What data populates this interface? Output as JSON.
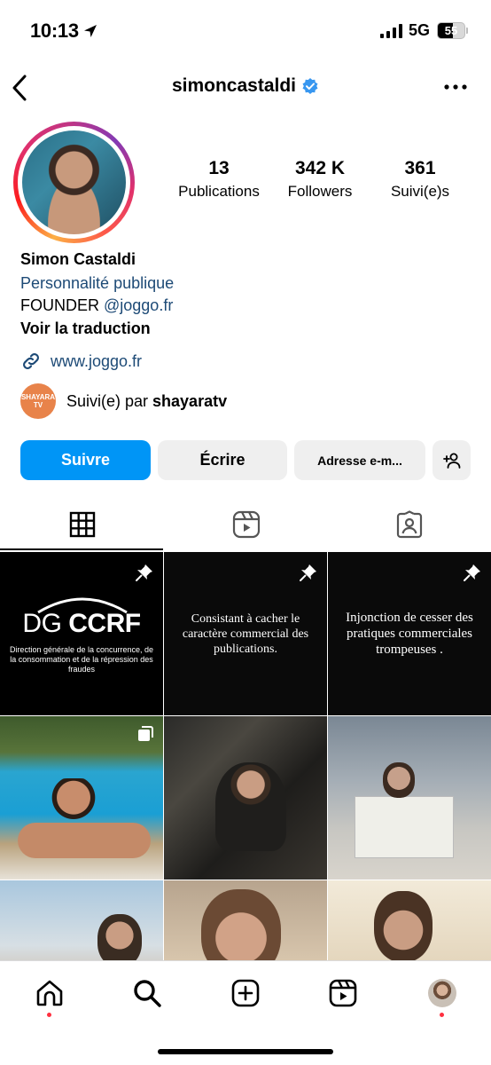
{
  "status_bar": {
    "time": "10:13",
    "network": "5G",
    "battery": "55",
    "battery_level": 0.55
  },
  "header": {
    "username": "simoncastaldi",
    "verified": true
  },
  "stats": [
    {
      "value": "13",
      "label": "Publications"
    },
    {
      "value": "342 K",
      "label": "Followers"
    },
    {
      "value": "361",
      "label": "Suivi(e)s"
    }
  ],
  "bio": {
    "name": "Simon Castaldi",
    "category": "Personnalité publique",
    "line_prefix": "FOUNDER ",
    "line_mention": "@joggo.fr",
    "translate": "Voir la traduction",
    "link": "www.joggo.fr"
  },
  "followed_by": {
    "prefix": "Suivi(e) par ",
    "user": "shayaratv",
    "avatar_text": "SHAYARA TV"
  },
  "actions": {
    "follow": "Suivre",
    "message": "Écrire",
    "email": "Adresse e-m..."
  },
  "tabs": [
    "grid-icon",
    "reels-icon",
    "tagged-icon"
  ],
  "posts": {
    "dgccrf_left": "DG",
    "dgccrf_right": "CCRF",
    "dgccrf_sub": "Direction générale de la concurrence, de la consommation et de la répression des fraudes",
    "post2": "Consistant à cacher le caractère commercial des publications.",
    "post3": "Injonction de cesser des pratiques commerciales trompeuses ."
  },
  "nav": [
    "home-icon",
    "search-icon",
    "create-icon",
    "reels-icon",
    "profile-avatar"
  ],
  "colors": {
    "accent": "#0095f6",
    "link": "#1d4a76",
    "notification": "#ff3040"
  }
}
